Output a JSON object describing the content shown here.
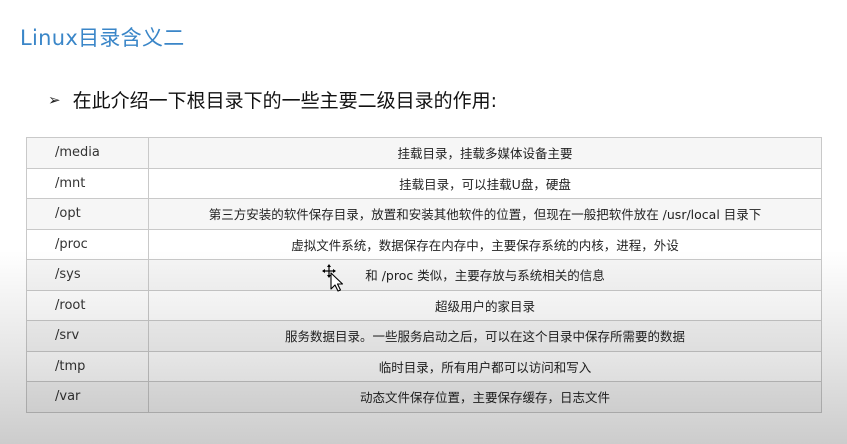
{
  "slide": {
    "title": "Linux目录含义二",
    "bullet_icon": "arrow-bullet-icon",
    "bullet": "在此介绍一下根目录下的一些主要二级目录的作用:"
  },
  "table": {
    "rows": [
      {
        "path": "/media",
        "desc": "挂载目录，挂载多媒体设备主要"
      },
      {
        "path": "/mnt",
        "desc": "挂载目录，可以挂载U盘，硬盘"
      },
      {
        "path": "/opt",
        "desc": "第三方安装的软件保存目录，放置和安装其他软件的位置，但现在一般把软件放在 /usr/local 目录下"
      },
      {
        "path": "/proc",
        "desc": "虚拟文件系统，数据保存在内存中，主要保存系统的内核，进程，外设"
      },
      {
        "path": "/sys",
        "desc": "和 /proc 类似，主要存放与系统相关的信息"
      },
      {
        "path": "/root",
        "desc": "超级用户的家目录"
      },
      {
        "path": "/srv",
        "desc": "服务数据目录。一些服务启动之后，可以在这个目录中保存所需要的数据"
      },
      {
        "path": "/tmp",
        "desc": "临时目录，所有用户都可以访问和写入"
      },
      {
        "path": "/var",
        "desc": "动态文件保存位置，主要保存缓存，日志文件"
      }
    ]
  },
  "cursor_icon": "move-cursor-icon",
  "colors": {
    "title": "#3a86c8",
    "border": "#c9c9c9",
    "row_alt": "#f6f6f6"
  }
}
